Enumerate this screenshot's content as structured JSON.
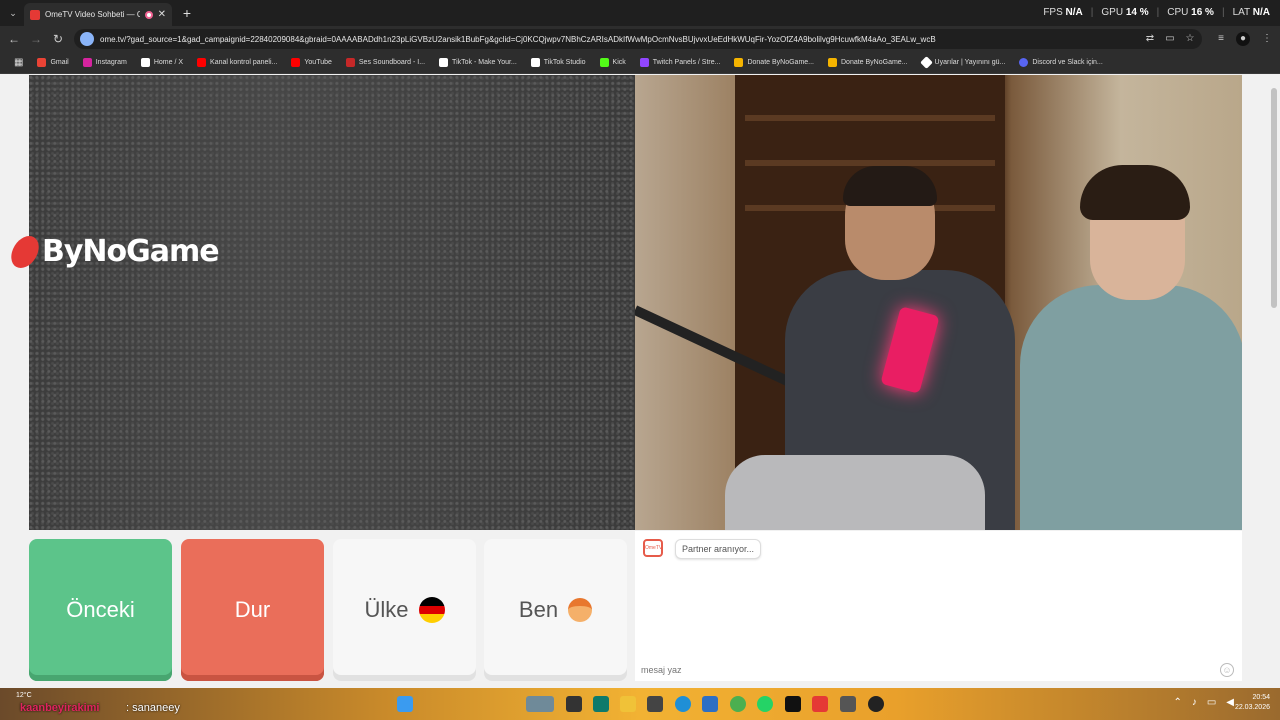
{
  "browser": {
    "tab_title": "OmeTV Video Sohbeti — C",
    "url": "ome.tv/?gad_source=1&gad_campaignid=22840209084&gbraid=0AAAABADdh1n23pLiGVBzU2ansik1BubFg&gclid=Cj0KCQjwpv7NBhCzARIsADkIfWwMpOcmNvsBUjvvxUeEdHkWUqFir-YozOfZ4A9bolilvg9HcuwfkM4aAo_3EALw_wcB",
    "stats": {
      "fps_label": "FPS",
      "fps_value": "N/A",
      "gpu_label": "GPU",
      "gpu_value": "14 %",
      "cpu_label": "CPU",
      "cpu_value": "16 %",
      "lat_label": "LAT",
      "lat_value": "N/A"
    },
    "bookmarks": [
      {
        "label": "Gmail",
        "color": "#ea4335"
      },
      {
        "label": "Instagram",
        "color": "#d6249f"
      },
      {
        "label": "Home / X",
        "color": "#ffffff"
      },
      {
        "label": "Kanal kontrol paneli...",
        "color": "#ff0000"
      },
      {
        "label": "YouTube",
        "color": "#ff0000"
      },
      {
        "label": "Ses Soundboard - I...",
        "color": "#c62828"
      },
      {
        "label": "TikTok - Make Your...",
        "color": "#ffffff"
      },
      {
        "label": "TikTok Studio",
        "color": "#ffffff"
      },
      {
        "label": "Kick",
        "color": "#53fc18"
      },
      {
        "label": "Twitch Panels / Stre...",
        "color": "#9146ff"
      },
      {
        "label": "Donate ByNoGame...",
        "color": "#f5b400"
      },
      {
        "label": "Donate ByNoGame...",
        "color": "#f5b400"
      },
      {
        "label": "Uyarılar | Yayınını gü...",
        "color": "#ffffff"
      },
      {
        "label": "Discord ve Slack için...",
        "color": "#5865f2"
      }
    ]
  },
  "page": {
    "brand": "ByNoGame",
    "buttons": {
      "prev": "Önceki",
      "stop": "Dur",
      "country": "Ülke",
      "me": "Ben"
    },
    "chat": {
      "logo": "OmeTV",
      "status_message": "Partner aranıyor...",
      "input_placeholder": "mesaj yaz"
    }
  },
  "taskbar": {
    "weather": "12°C",
    "overlay_name": "kaanbeyirakimi",
    "overlay_text": ": sananeey",
    "time": "20:54",
    "date": "22.03.2026"
  }
}
